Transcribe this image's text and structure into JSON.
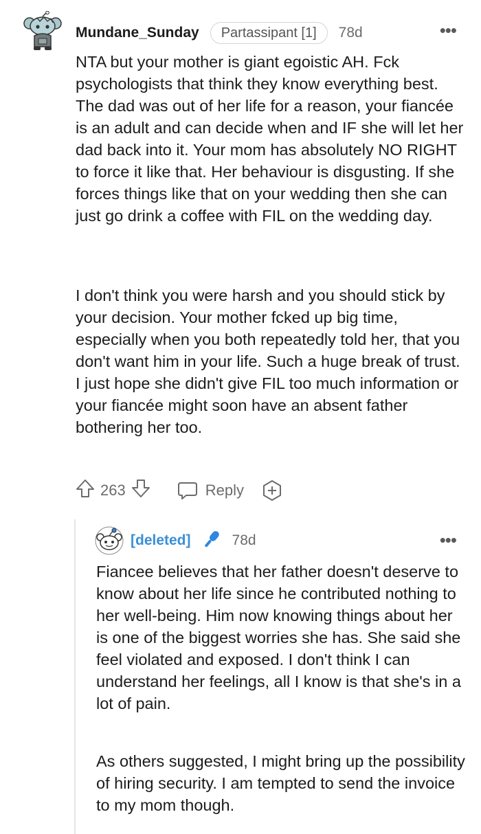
{
  "comment": {
    "username": "Mundane_Sunday",
    "flair": "Partassipant [1]",
    "age": "78d",
    "more_icon": "ellipsis-icon",
    "paragraphs": [
      "NTA but your mother is giant egoistic AH. Fck psychologists that think they know everything best. The dad was out of her life for a reason, your fiancée is an adult and can decide when and IF she will let her dad back into it. Your mom has absolutely NO RIGHT to force it like that. Her behaviour is disgusting. If she forces things like that on your wedding then she can just go drink a coffee with FIL on the wedding day.",
      "I don't think you were harsh and you should stick by your decision. Your mother fcked up big time, especially when you both repeatedly told her, that you don't want him in your life. Such a huge break of trust. I just hope she didn't give FIL too much information or your fiancée might soon have an absent father bothering her too."
    ],
    "votes": "263",
    "reply_label": "Reply"
  },
  "reply": {
    "username": "[deleted]",
    "age": "78d",
    "paragraphs": [
      "Fiancee believes that her father doesn't deserve to know about her life since he contributed nothing to her well-being. Him now knowing things about her is one of the biggest worries she has. She said she feel violated and exposed. I don't think I can understand her feelings, all I know is that she's in a lot of pain.",
      "As others suggested, I might bring up the possibility of hiring security. I am tempted to send the invoice to my mom though."
    ]
  },
  "colors": {
    "text": "#1c1c1c",
    "muted": "#6b6b6b",
    "deleted_user": "#3a8fd6",
    "mic": "#2f86e0",
    "thread_line": "#e5e5e5"
  }
}
